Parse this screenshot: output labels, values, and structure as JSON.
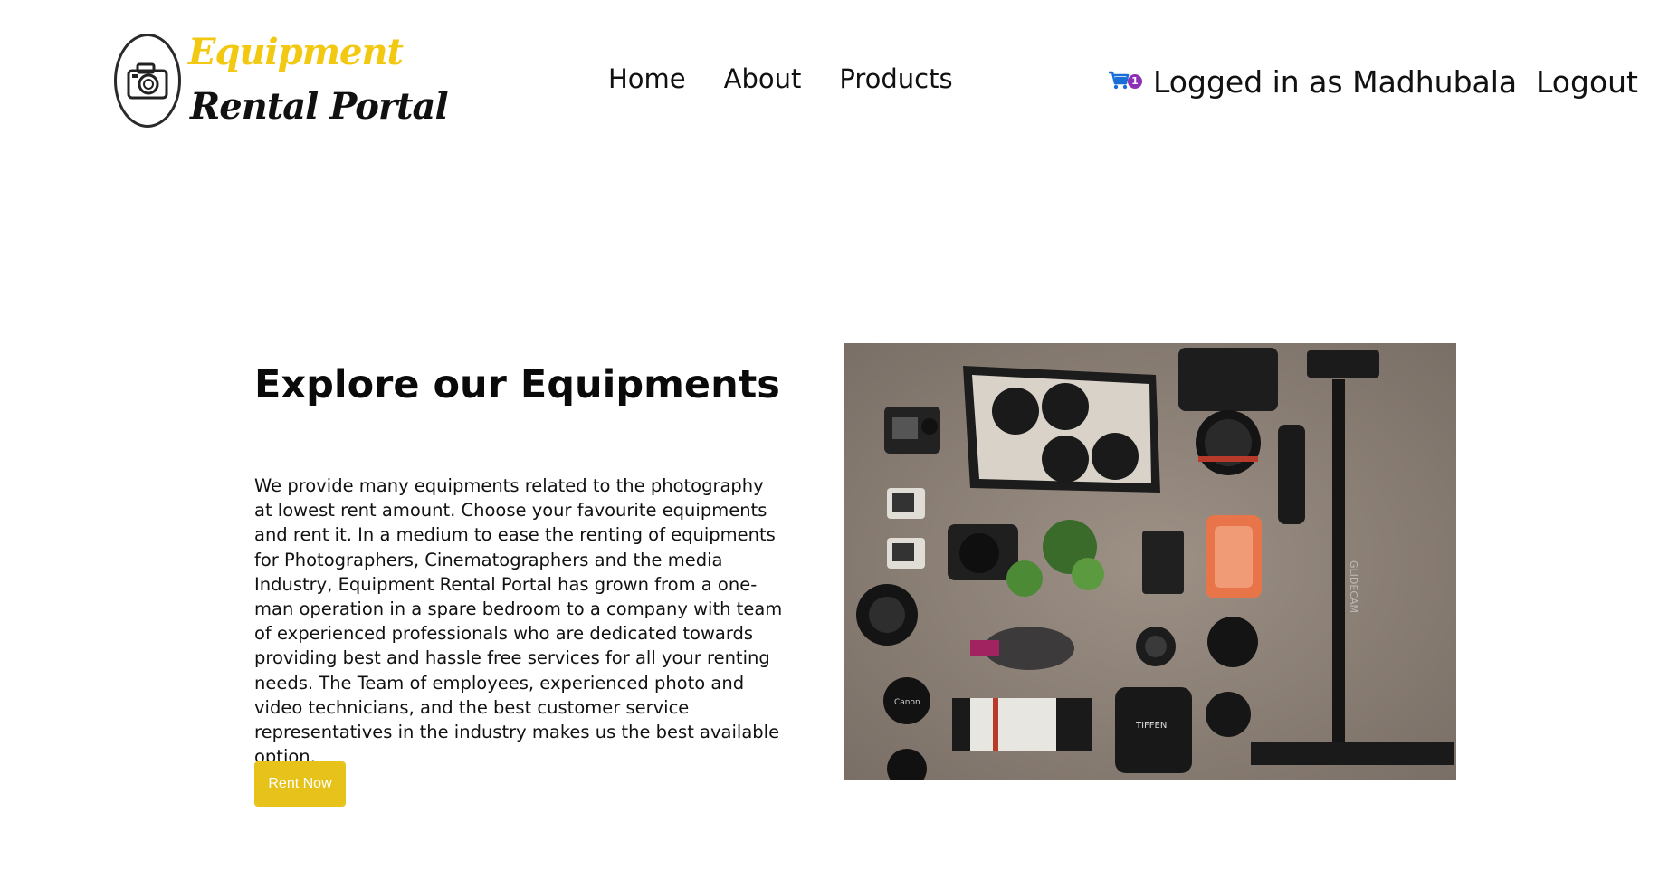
{
  "header": {
    "logo": {
      "line1": "Equipment",
      "line2": "Rental Portal",
      "icon": "camera-icon",
      "line1_color": "#f2c811"
    },
    "nav": [
      {
        "label": "Home"
      },
      {
        "label": "About"
      },
      {
        "label": "Products"
      }
    ],
    "cart": {
      "icon": "cart-icon",
      "count": "1",
      "badge_color": "#8e2fb8",
      "icon_color": "#1a6fd6"
    },
    "user_label": "Logged in as Madhubala",
    "logout_label": "Logout"
  },
  "hero": {
    "title": "Explore our Equipments",
    "description": "We provide many equipments related to the photography at lowest rent amount. Choose your favourite equipments and rent it. In a medium to ease the renting of equipments for Photographers, Cinematographers and the media Industry, Equipment Rental Portal has grown from a one-man operation in a spare bedroom to a company with team of experienced professionals who are dedicated towards providing best and hassle free services for all your renting needs. The Team of employees, experienced photo and video technicians, and the best customer service representatives in the industry makes us the best available option.",
    "cta_label": "Rent Now",
    "cta_color": "#e6c21a",
    "image": {
      "description_icon": "camera-gear-flatlay-image",
      "labels": {
        "stabilizer": "GLIDECAM",
        "lens_cap": "Canon",
        "bag": "TIFFEN"
      }
    }
  }
}
